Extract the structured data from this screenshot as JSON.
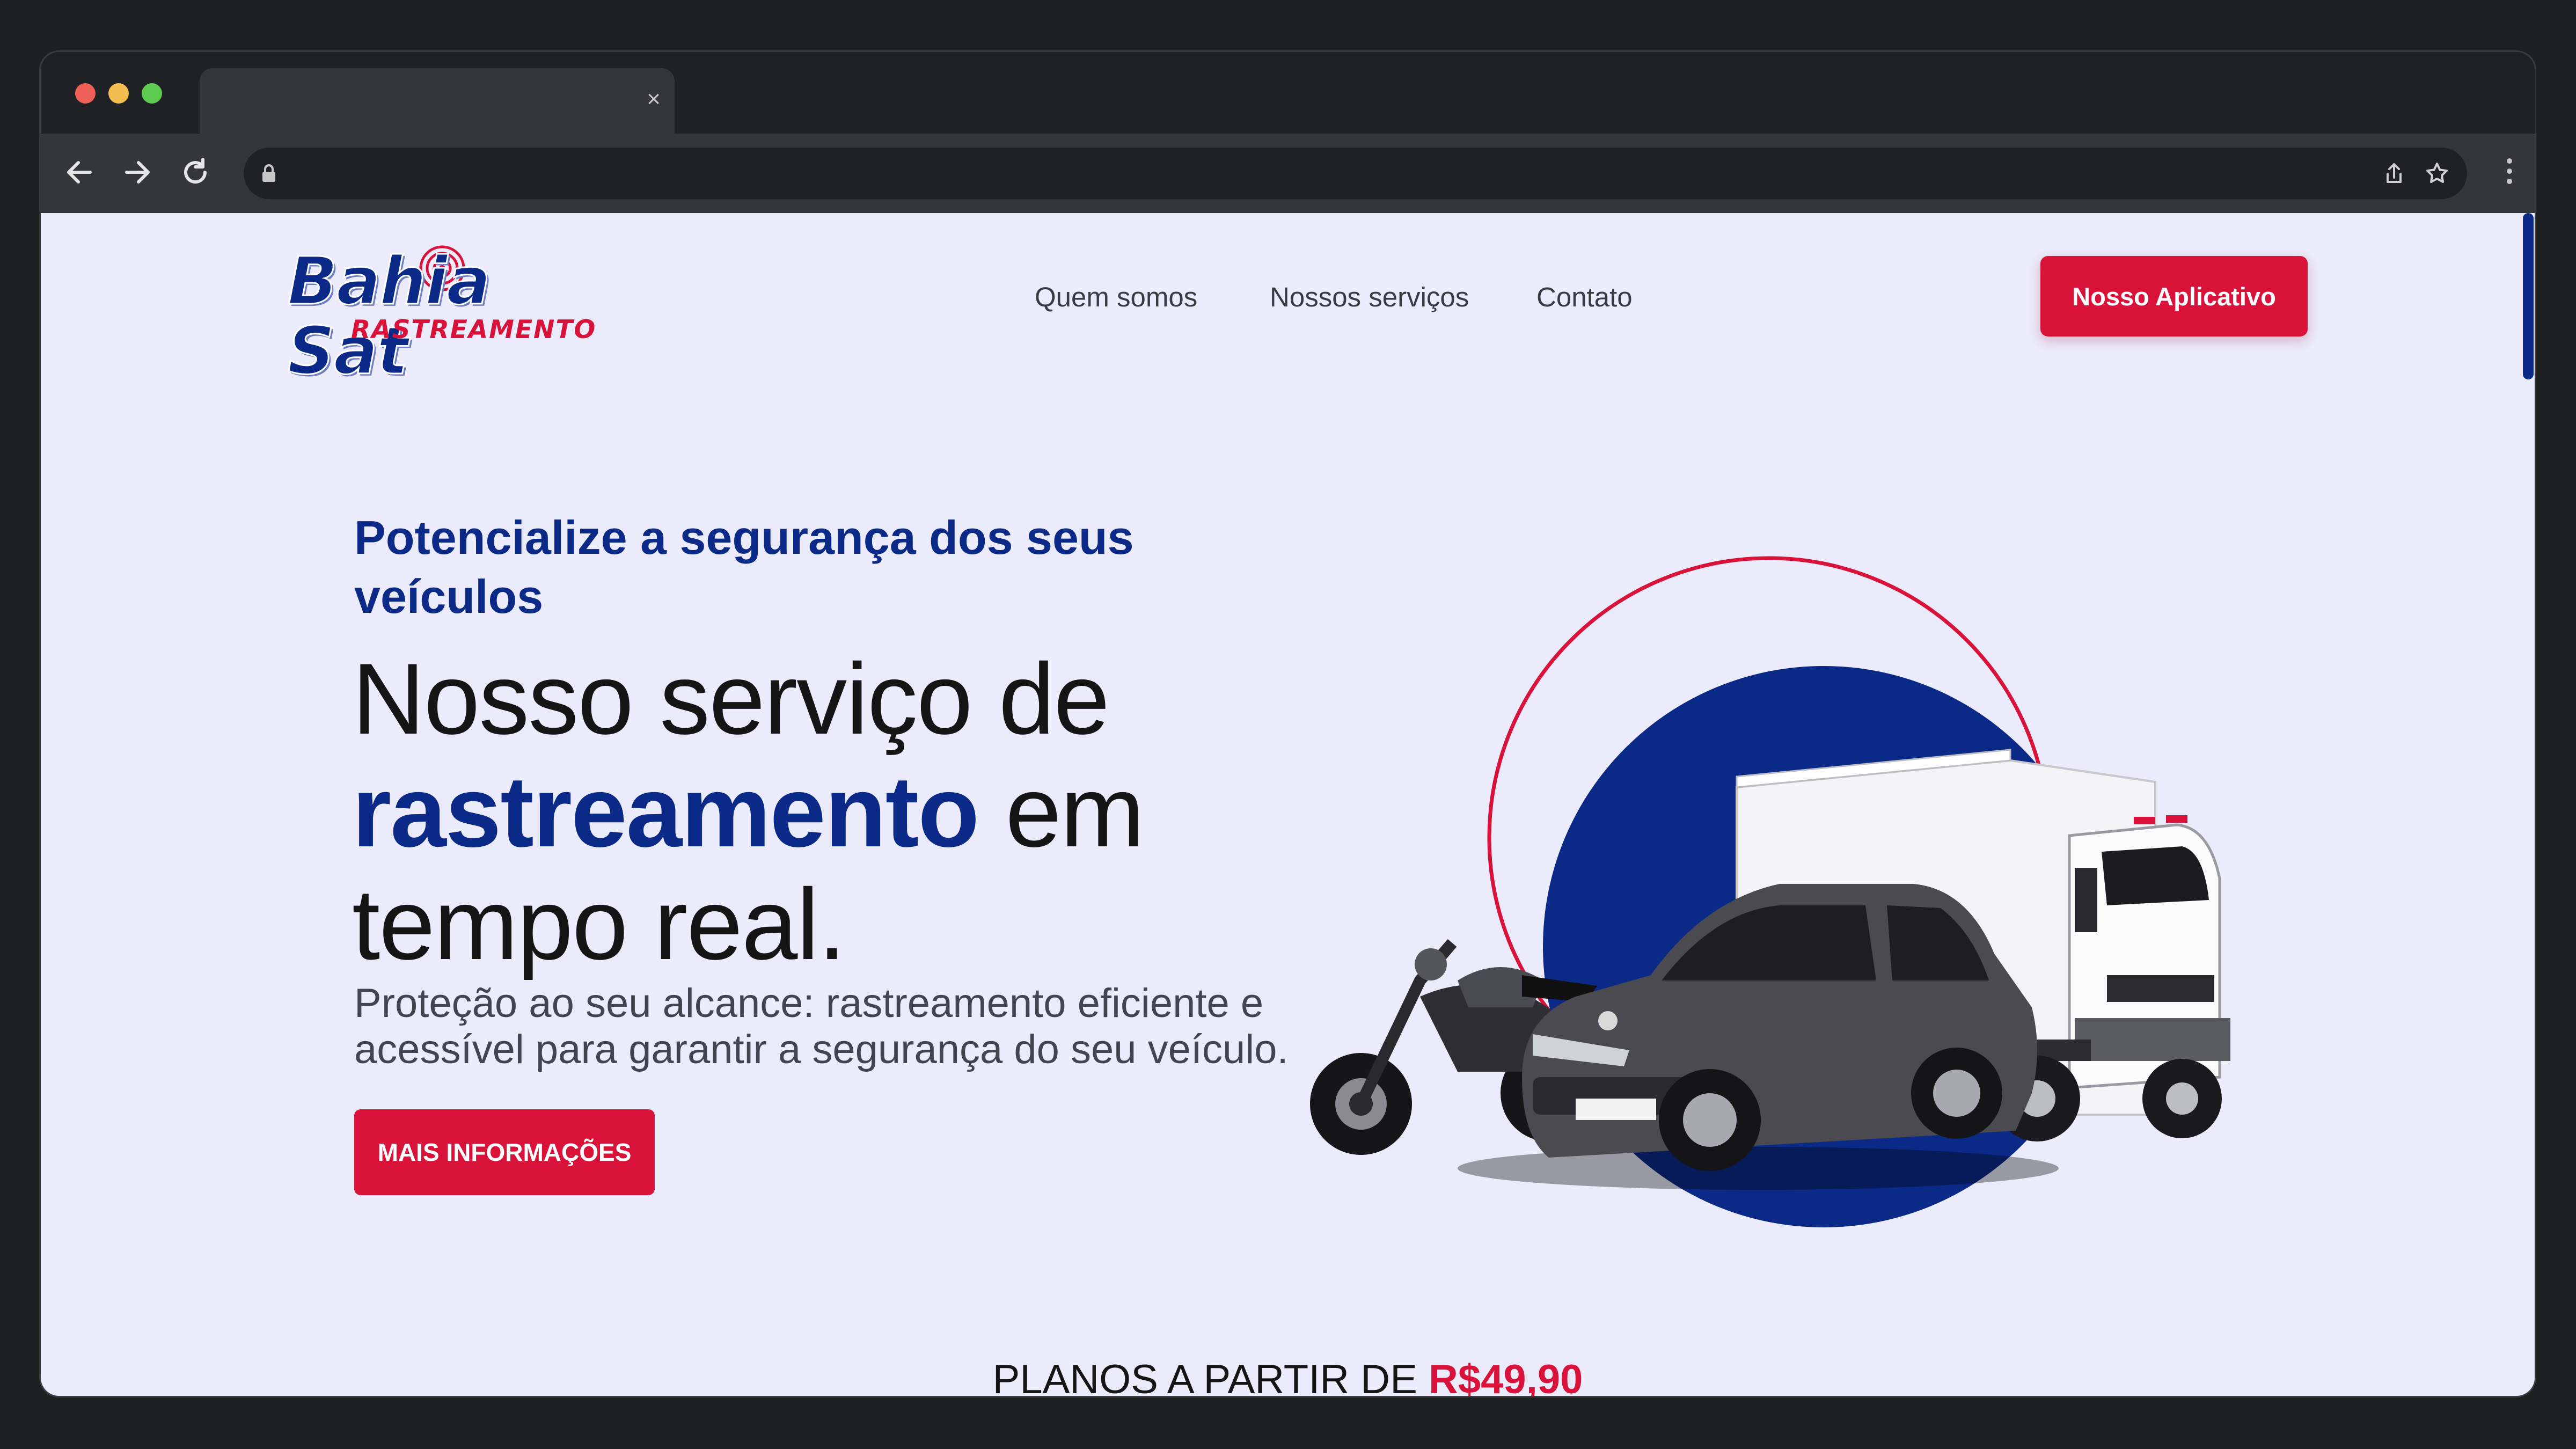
{
  "browser": {
    "tab_close_glyph": "×",
    "traffic_colors": [
      "#ee5f57",
      "#f4bd4f",
      "#5ccb50"
    ]
  },
  "header": {
    "logo_text": "Bahia Sat",
    "logo_subtitle": "RASTREAMENTO",
    "nav": [
      "Quem somos",
      "Nossos serviços",
      "Contato"
    ],
    "cta_label": "Nosso Aplicativo"
  },
  "hero": {
    "eyebrow": "Potencialize a segurança dos seus veículos",
    "headline_part1": "Nosso serviço de",
    "headline_highlight": "rastreamento",
    "headline_part2": "em",
    "headline_part3": "tempo real.",
    "subtext": "Proteção ao seu alcance: rastreamento eficiente e acessível para garantir a segurança do seu veículo.",
    "button_label": "MAIS INFORMAÇÕES"
  },
  "plans": {
    "label": "PLANOS A PARTIR DE",
    "price": "R$49,90"
  },
  "colors": {
    "brand_blue": "#0b2a87",
    "brand_red": "#d9123a",
    "page_bg": "#ebebfb"
  },
  "icons": {
    "back": "arrow-left-icon",
    "forward": "arrow-right-icon",
    "reload": "reload-icon",
    "lock": "lock-icon",
    "share": "share-icon",
    "bookmark": "star-icon",
    "menu": "kebab-menu-icon"
  }
}
